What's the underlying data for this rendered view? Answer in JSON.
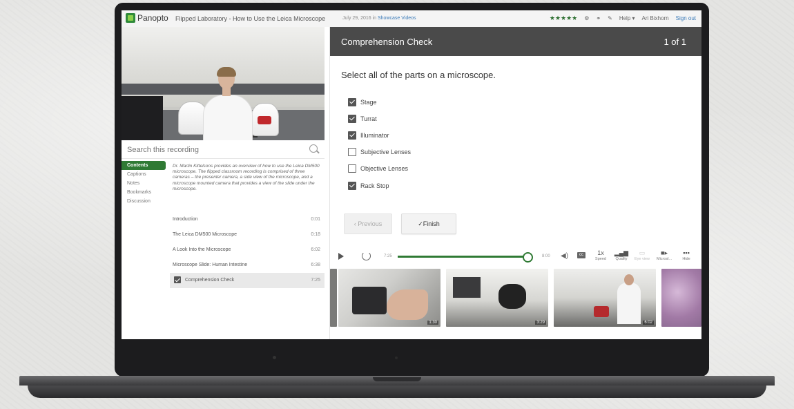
{
  "header": {
    "logo_text": "Panopto",
    "title": "Flipped Laboratory - How to Use the Leica Microscope",
    "date_prefix": "July 29, 2016 in",
    "folder": "Showcase Videos",
    "rating": "★★★★★",
    "help": "Help ▾",
    "user": "Ari Bixhorn",
    "signout": "Sign out"
  },
  "search": {
    "placeholder": "Search this recording"
  },
  "left_nav": [
    "Contents",
    "Captions",
    "Notes",
    "Bookmarks",
    "Discussion"
  ],
  "description": "Dr. Martin Kittelsons provides an overview of how to use the Leica DM500 microscope. The flipped classroom recording is comprised of three cameras – the presenter camera, a side view of the microscope, and a microscope mounted camera that provides a view of the slide under the microscope.",
  "chapters": [
    {
      "title": "Introduction",
      "time": "0:01"
    },
    {
      "title": "The Leica DM500 Microscope",
      "time": "0:18"
    },
    {
      "title": "A Look Into the Microscope",
      "time": "6:02"
    },
    {
      "title": "Microscope Slide: Human Intestine",
      "time": "6:38"
    },
    {
      "title": "Comprehension Check",
      "time": "7:25"
    }
  ],
  "quiz": {
    "title": "Comprehension Check",
    "count": "1 of 1",
    "prompt": "Select all of the parts on a microscope.",
    "options": [
      {
        "label": "Stage",
        "checked": true
      },
      {
        "label": "Turrat",
        "checked": true
      },
      {
        "label": "Illuminator",
        "checked": true
      },
      {
        "label": "Subjective Lenses",
        "checked": false
      },
      {
        "label": "Objective Lenses",
        "checked": false
      },
      {
        "label": "Rack Stop",
        "checked": true
      }
    ],
    "prev_label": "‹ Previous",
    "finish_label": "✓Finish"
  },
  "player": {
    "time_start": "7:25",
    "time_end": "8:00",
    "progress": 0.96,
    "speed_value": "1x",
    "speed_label": "Speed",
    "quality_label": "Quality",
    "disabled_label": "Eye view",
    "micro_label": "Microsl...",
    "hide_label": "Hide"
  },
  "thumbnails": [
    "1:30",
    "3:29",
    "6:02",
    ""
  ],
  "colors": {
    "accent": "#2f7a34",
    "quiz_header": "#4a4a4a"
  }
}
